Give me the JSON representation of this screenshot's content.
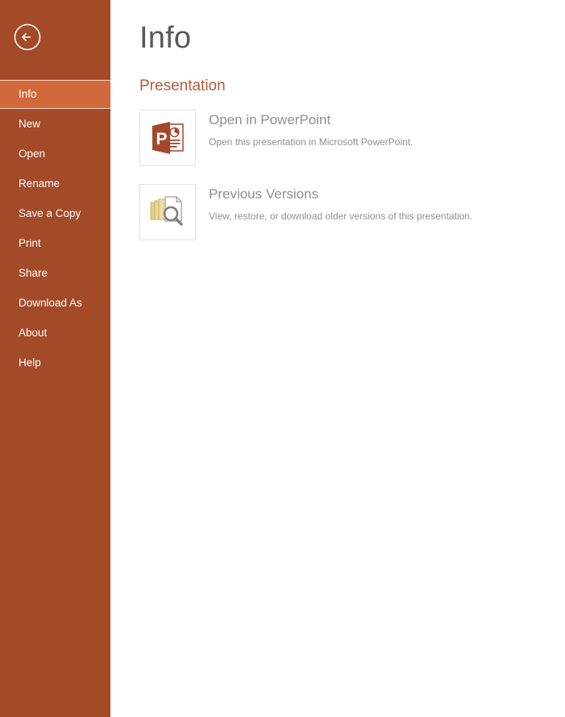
{
  "sidebar": {
    "back_button": {
      "name": "back-arrow-icon",
      "label": "Back"
    },
    "bg_color": "#a34a28",
    "active_bg_color": "#d2693b",
    "items": [
      {
        "label": "Info",
        "active": true
      },
      {
        "label": "New",
        "active": false
      },
      {
        "label": "Open",
        "active": false
      },
      {
        "label": "Rename",
        "active": false
      },
      {
        "label": "Save a Copy",
        "active": false
      },
      {
        "label": "Print",
        "active": false
      },
      {
        "label": "Share",
        "active": false
      },
      {
        "label": "Download As",
        "active": false
      },
      {
        "label": "About",
        "active": false
      },
      {
        "label": "Help",
        "active": false
      }
    ]
  },
  "main": {
    "page_title": "Info",
    "section_title": "Presentation",
    "section_title_color": "#b05c38",
    "tiles": [
      {
        "icon": "powerpoint-logo-icon",
        "title": "Open in PowerPoint",
        "description": "Open this presentation in Microsoft PowerPoint."
      },
      {
        "icon": "previous-versions-icon",
        "title": "Previous Versions",
        "description": "View, restore, or download older versions of this presentation."
      }
    ]
  }
}
